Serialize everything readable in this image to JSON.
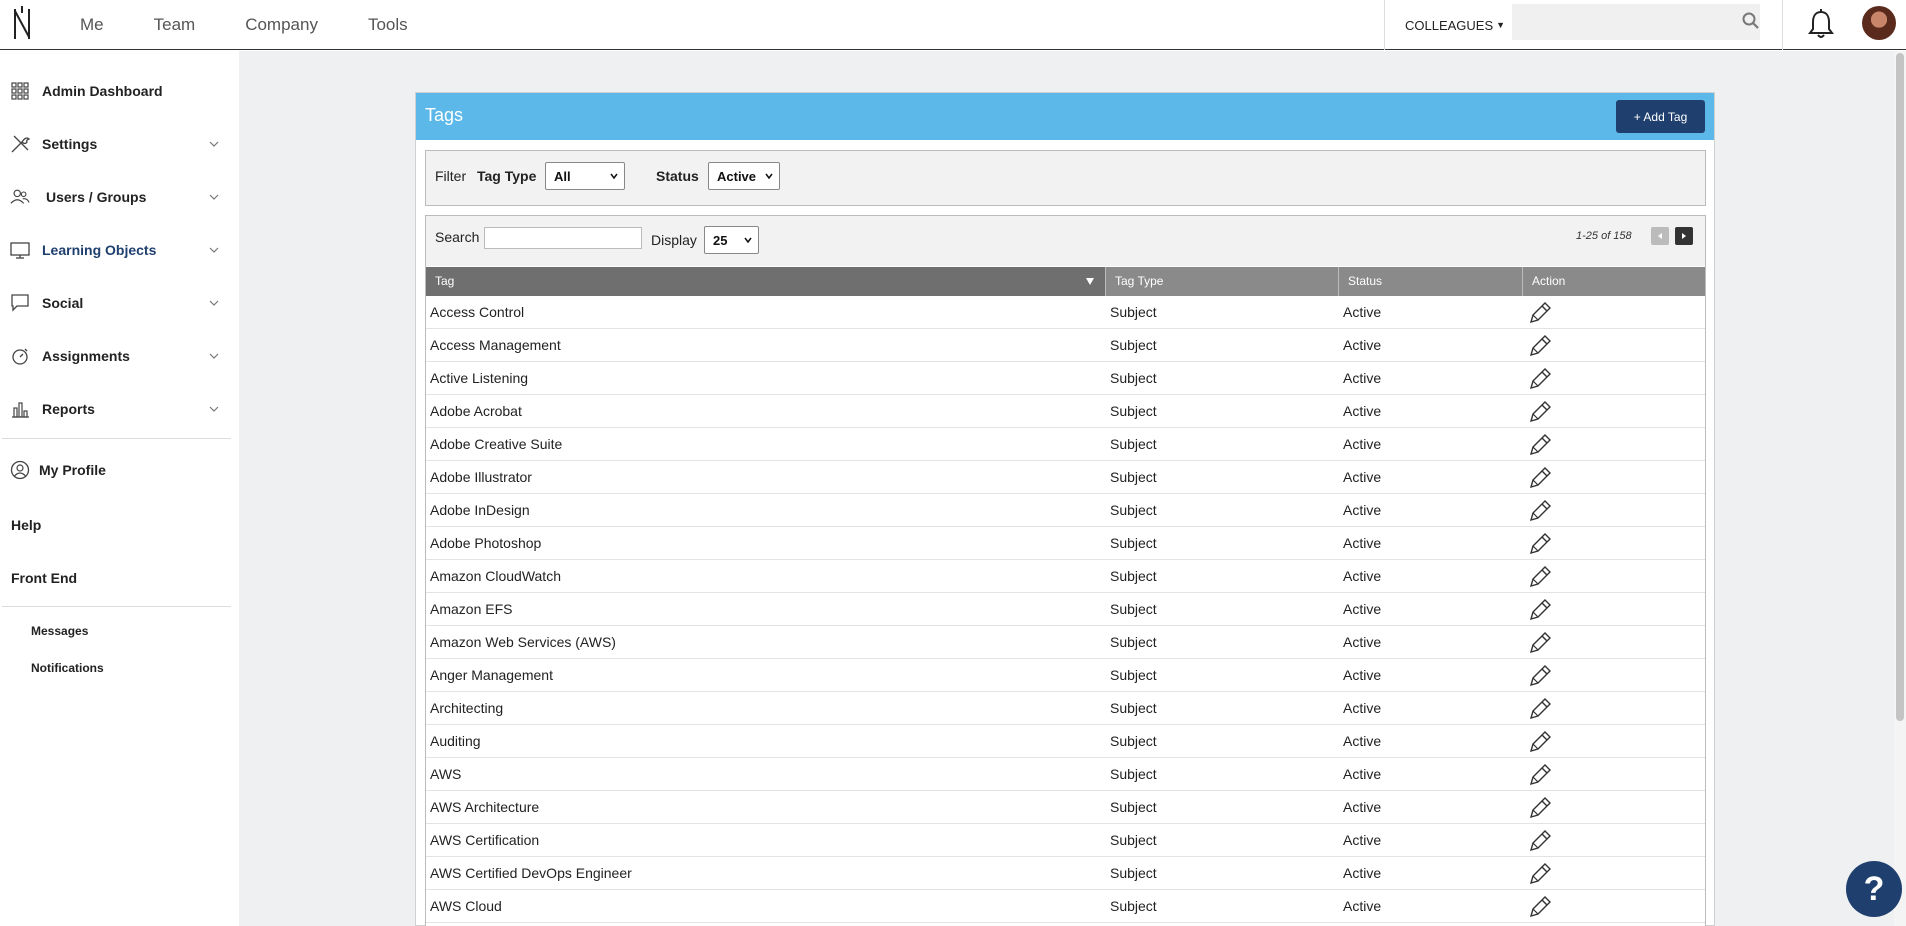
{
  "topnav": {
    "items": [
      "Me",
      "Team",
      "Company",
      "Tools"
    ],
    "colleagues_label": "COLLEAGUES",
    "search_placeholder": ""
  },
  "sidebar": {
    "items": [
      {
        "label": "Admin Dashboard",
        "icon": "grid-icon",
        "expandable": false
      },
      {
        "label": "Settings",
        "icon": "tools-icon",
        "expandable": true
      },
      {
        "label": "Users / Groups",
        "icon": "users-icon",
        "expandable": true
      },
      {
        "label": "Learning Objects",
        "icon": "monitor-icon",
        "expandable": true
      },
      {
        "label": "Social",
        "icon": "chat-icon",
        "expandable": true
      },
      {
        "label": "Assignments",
        "icon": "stopwatch-icon",
        "expandable": true
      },
      {
        "label": "Reports",
        "icon": "bar-chart-icon",
        "expandable": true
      }
    ],
    "my_profile": "My Profile",
    "help": "Help",
    "front_end": "Front End",
    "messages": "Messages",
    "notifications": "Notifications"
  },
  "panel": {
    "title": "Tags",
    "add_button": "+ Add Tag"
  },
  "filter": {
    "filter_label": "Filter",
    "tag_type_label": "Tag Type",
    "tag_type_value": "All",
    "status_label": "Status",
    "status_value": "Active"
  },
  "toolbar": {
    "search_label": "Search",
    "search_value": "",
    "display_label": "Display",
    "display_value": "25",
    "page_info": "1-25 of 158"
  },
  "table": {
    "headers": {
      "tag": "Tag",
      "tag_type": "Tag Type",
      "status": "Status",
      "action": "Action"
    },
    "rows": [
      {
        "tag": "Access Control",
        "type": "Subject",
        "status": "Active"
      },
      {
        "tag": "Access Management",
        "type": "Subject",
        "status": "Active"
      },
      {
        "tag": "Active Listening",
        "type": "Subject",
        "status": "Active"
      },
      {
        "tag": "Adobe Acrobat",
        "type": "Subject",
        "status": "Active"
      },
      {
        "tag": "Adobe Creative Suite",
        "type": "Subject",
        "status": "Active"
      },
      {
        "tag": "Adobe Illustrator",
        "type": "Subject",
        "status": "Active"
      },
      {
        "tag": "Adobe InDesign",
        "type": "Subject",
        "status": "Active"
      },
      {
        "tag": "Adobe Photoshop",
        "type": "Subject",
        "status": "Active"
      },
      {
        "tag": "Amazon CloudWatch",
        "type": "Subject",
        "status": "Active"
      },
      {
        "tag": "Amazon EFS",
        "type": "Subject",
        "status": "Active"
      },
      {
        "tag": "Amazon Web Services (AWS)",
        "type": "Subject",
        "status": "Active"
      },
      {
        "tag": "Anger Management",
        "type": "Subject",
        "status": "Active"
      },
      {
        "tag": "Architecting",
        "type": "Subject",
        "status": "Active"
      },
      {
        "tag": "Auditing",
        "type": "Subject",
        "status": "Active"
      },
      {
        "tag": "AWS",
        "type": "Subject",
        "status": "Active"
      },
      {
        "tag": "AWS Architecture",
        "type": "Subject",
        "status": "Active"
      },
      {
        "tag": "AWS Certification",
        "type": "Subject",
        "status": "Active"
      },
      {
        "tag": "AWS Certified DevOps Engineer",
        "type": "Subject",
        "status": "Active"
      },
      {
        "tag": "AWS Cloud",
        "type": "Subject",
        "status": "Active"
      }
    ]
  },
  "help_button": "?",
  "colors": {
    "panel_header": "#5bb8e8",
    "primary_button": "#1f3f6e",
    "table_header": "#8a8a8a",
    "content_bg": "#eef0f2"
  }
}
